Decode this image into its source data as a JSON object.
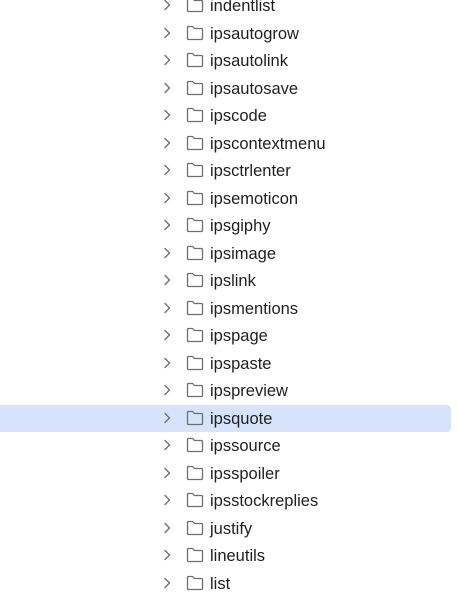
{
  "tree": {
    "selected_index": 15,
    "items": [
      {
        "label": "indentlist",
        "icon": "folder-icon",
        "expander": "chevron-right-icon"
      },
      {
        "label": "ipsautogrow",
        "icon": "folder-icon",
        "expander": "chevron-right-icon"
      },
      {
        "label": "ipsautolink",
        "icon": "folder-icon",
        "expander": "chevron-right-icon"
      },
      {
        "label": "ipsautosave",
        "icon": "folder-icon",
        "expander": "chevron-right-icon"
      },
      {
        "label": "ipscode",
        "icon": "folder-icon",
        "expander": "chevron-right-icon"
      },
      {
        "label": "ipscontextmenu",
        "icon": "folder-icon",
        "expander": "chevron-right-icon"
      },
      {
        "label": "ipsctrlenter",
        "icon": "folder-icon",
        "expander": "chevron-right-icon"
      },
      {
        "label": "ipsemoticon",
        "icon": "folder-icon",
        "expander": "chevron-right-icon"
      },
      {
        "label": "ipsgiphy",
        "icon": "folder-icon",
        "expander": "chevron-right-icon"
      },
      {
        "label": "ipsimage",
        "icon": "folder-icon",
        "expander": "chevron-right-icon"
      },
      {
        "label": "ipslink",
        "icon": "folder-icon",
        "expander": "chevron-right-icon"
      },
      {
        "label": "ipsmentions",
        "icon": "folder-icon",
        "expander": "chevron-right-icon"
      },
      {
        "label": "ipspage",
        "icon": "folder-icon",
        "expander": "chevron-right-icon"
      },
      {
        "label": "ipspaste",
        "icon": "folder-icon",
        "expander": "chevron-right-icon"
      },
      {
        "label": "ipspreview",
        "icon": "folder-icon",
        "expander": "chevron-right-icon"
      },
      {
        "label": "ipsquote",
        "icon": "folder-icon",
        "expander": "chevron-right-icon"
      },
      {
        "label": "ipssource",
        "icon": "folder-icon",
        "expander": "chevron-right-icon"
      },
      {
        "label": "ipsspoiler",
        "icon": "folder-icon",
        "expander": "chevron-right-icon"
      },
      {
        "label": "ipsstockreplies",
        "icon": "folder-icon",
        "expander": "chevron-right-icon"
      },
      {
        "label": "justify",
        "icon": "folder-icon",
        "expander": "chevron-right-icon"
      },
      {
        "label": "lineutils",
        "icon": "folder-icon",
        "expander": "chevron-right-icon"
      },
      {
        "label": "list",
        "icon": "folder-icon",
        "expander": "chevron-right-icon"
      }
    ]
  },
  "colors": {
    "selection": "#d5e3fb",
    "text": "#1f1f1f",
    "icon": "#6e6e6e"
  }
}
